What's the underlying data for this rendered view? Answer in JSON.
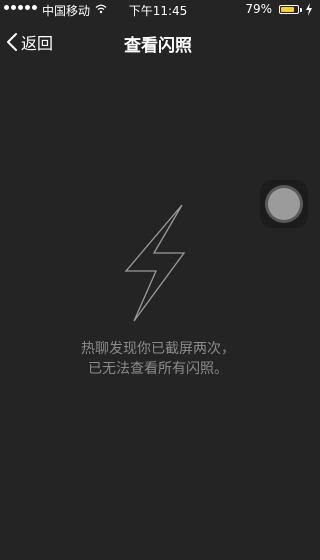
{
  "status_bar": {
    "carrier": "中国移动",
    "time": "下午11:45",
    "battery_percent": "79%",
    "battery_level": 0.79,
    "battery_color": "#f2d32e",
    "icons": [
      "signal-dots-icon",
      "wifi-icon",
      "battery-icon",
      "charging-icon"
    ]
  },
  "nav": {
    "back_label": "返回",
    "back_icon": "chevron-left-icon",
    "title": "查看闪照"
  },
  "content": {
    "icon": "lightning-bolt-icon",
    "message_line1": "热聊发现你已截屏两次，",
    "message_line2": "已无法查看所有闪照。"
  },
  "colors": {
    "background": "#242424",
    "message_text": "#8a8a8a"
  }
}
